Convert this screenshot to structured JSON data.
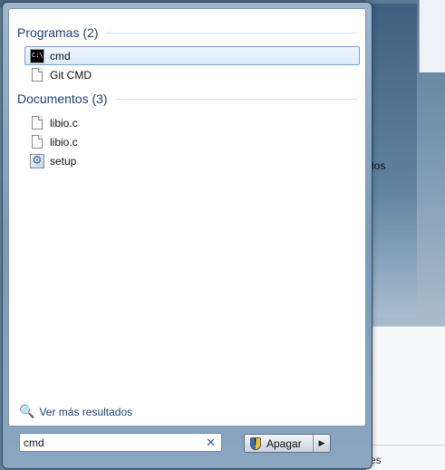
{
  "start_menu": {
    "groups": [
      {
        "header": "Programas (2)",
        "items": [
          {
            "label": "cmd",
            "icon": "cmd-icon",
            "selected": true
          },
          {
            "label": "Git CMD",
            "icon": "file-icon",
            "selected": false
          }
        ]
      },
      {
        "header": "Documentos (3)",
        "items": [
          {
            "label": "libio.c",
            "icon": "file-icon",
            "selected": false
          },
          {
            "label": "libio.c",
            "icon": "file-icon",
            "selected": false
          },
          {
            "label": "setup",
            "icon": "setup-icon",
            "selected": false
          }
        ]
      }
    ],
    "more_results": "Ver más resultados",
    "search": {
      "value": "cmd",
      "clear_icon": "close-icon"
    },
    "shutdown": {
      "label": "Apagar",
      "icon": "uac-shield-icon",
      "arrow_icon": "chevron-right-icon"
    }
  },
  "background": {
    "fragment_1": "dos",
    "fragment_2": "es"
  },
  "colors": {
    "header_text": "#1e3f7a",
    "selection_border": "#7da2ce",
    "frame": "#7d9ab6"
  }
}
